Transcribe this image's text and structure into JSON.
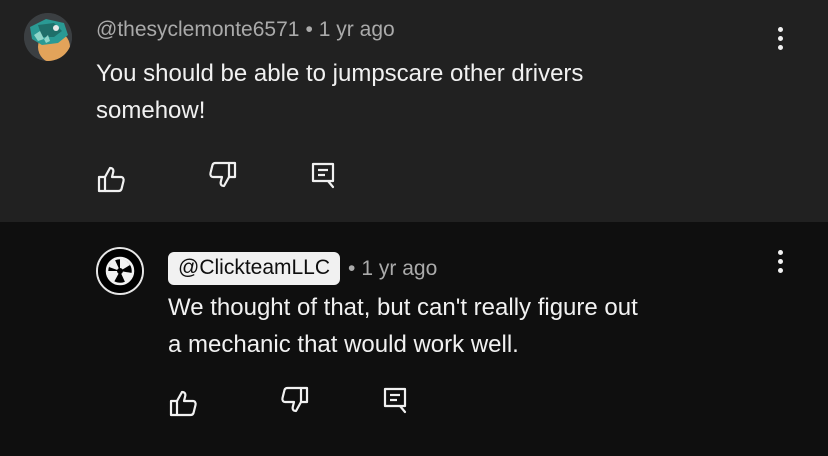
{
  "comment": {
    "handle": "@thesyclemonte6571",
    "separator": "•",
    "time": "1 yr ago",
    "lines": [
      "You should be able to jumpscare other drivers",
      "somehow!"
    ],
    "actions": [
      "like-icon",
      "dislike-icon",
      "reply-icon"
    ],
    "avatar_colors": {
      "bg": "#3b3f42",
      "teal": "#2a9a94",
      "orange": "#e2a35a"
    }
  },
  "reply": {
    "handle": "@ClickteamLLC",
    "separator": "•",
    "time": "1 yr ago",
    "lines": [
      "We thought of that, but can't really figure out",
      "a mechanic that would work well."
    ],
    "actions": [
      "like-icon",
      "dislike-icon",
      "reply-icon"
    ]
  },
  "colors": {
    "comment_bg": "#212121",
    "reply_bg": "#0f0f0f",
    "text": "#f1f1f1",
    "meta": "#aaaaaa"
  }
}
